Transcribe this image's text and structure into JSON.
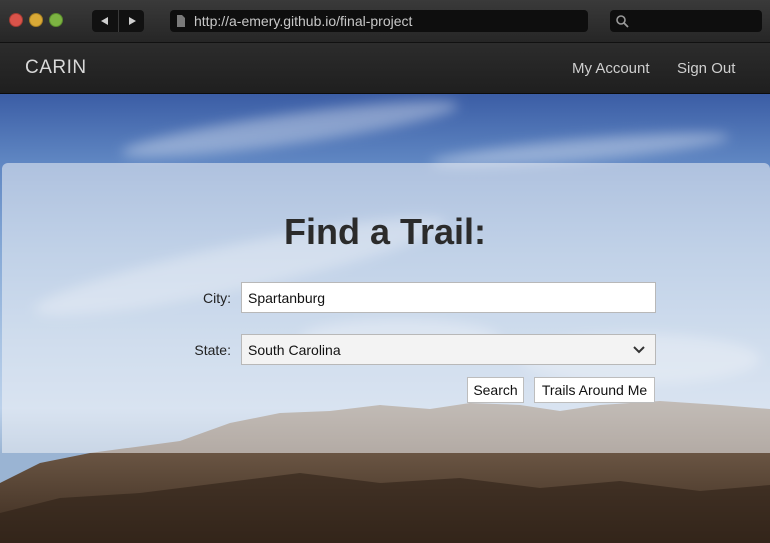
{
  "browser": {
    "url": "http://a-emery.github.io/final-project",
    "icons": [
      "back-arrow-icon",
      "forward-arrow-icon",
      "page-icon",
      "search-icon"
    ]
  },
  "nav": {
    "brand": "CARIN",
    "links": [
      "My Account",
      "Sign Out"
    ]
  },
  "form": {
    "title": "Find a Trail:",
    "city_label": "City:",
    "city_value": "Spartanburg",
    "state_label": "State:",
    "state_value": "South Carolina",
    "search_button": "Search",
    "around_button": "Trails Around Me"
  },
  "colors": {
    "chrome": "#2e2e2e",
    "nav": "#252525",
    "close": "#d9534a",
    "minimize": "#d9a936",
    "maximize": "#7cb342"
  }
}
